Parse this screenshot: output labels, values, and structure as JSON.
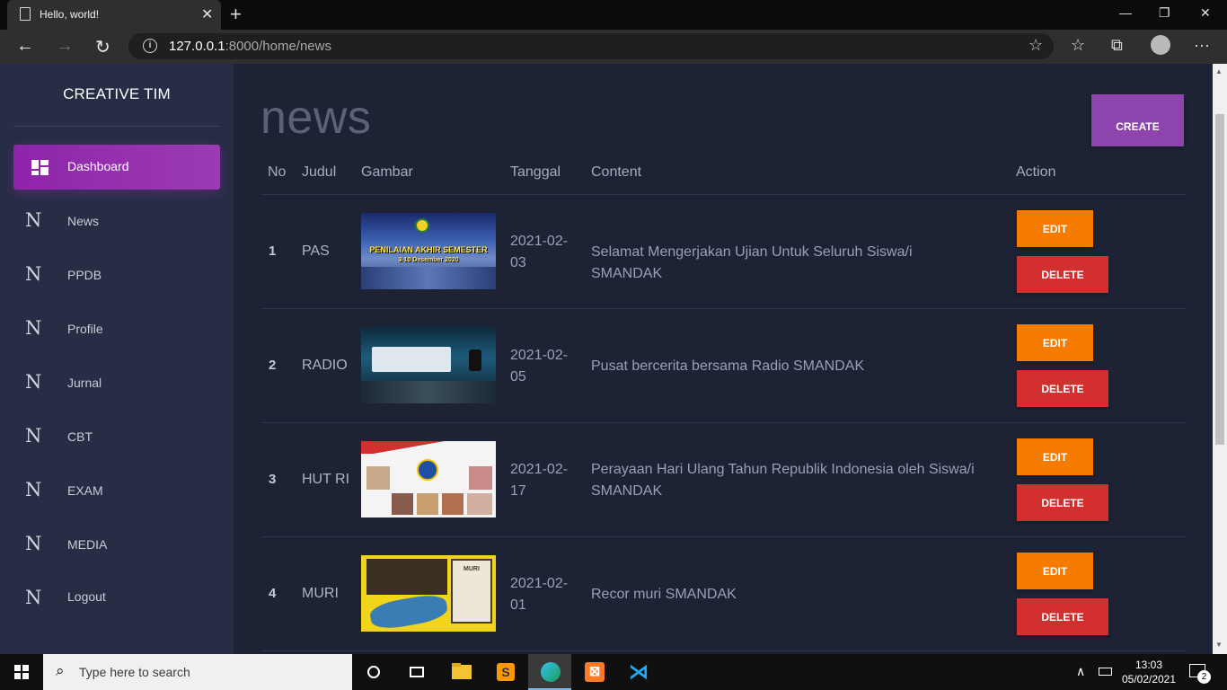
{
  "browser": {
    "tab_title": "Hello, world!",
    "url_host": "127.0.0.1",
    "url_rest": ":8000/home/news"
  },
  "sidebar": {
    "brand": "CREATIVE TIM",
    "active_item": "Dashboard",
    "items": [
      {
        "icon": "N",
        "label": "News"
      },
      {
        "icon": "N",
        "label": "PPDB"
      },
      {
        "icon": "N",
        "label": "Profile"
      },
      {
        "icon": "N",
        "label": "Jurnal"
      },
      {
        "icon": "N",
        "label": "CBT"
      },
      {
        "icon": "N",
        "label": "EXAM"
      },
      {
        "icon": "N",
        "label": "MEDIA"
      },
      {
        "icon": "N",
        "label": "Logout"
      }
    ]
  },
  "main": {
    "title": "news",
    "create_label": "CREATE",
    "columns": [
      "No",
      "Judul",
      "Gambar",
      "Tanggal",
      "Content",
      "Action"
    ],
    "rows": [
      {
        "no": "1",
        "judul": "PAS",
        "tanggal": "2021-02-03",
        "content": "Selamat Mengerjakan Ujian Untuk Seluruh Siswa/i SMANDAK",
        "img_text1": "PENILAIAN AKHIR SEMESTER",
        "img_text2": "3-10 Desember 2020"
      },
      {
        "no": "2",
        "judul": "RADIO",
        "tanggal": "2021-02-05",
        "content": "Pusat bercerita bersama Radio SMANDAK"
      },
      {
        "no": "3",
        "judul": "HUT RI",
        "tanggal": "2021-02-17",
        "content": "Perayaan Hari Ulang Tahun Republik Indonesia oleh Siswa/i SMANDAK"
      },
      {
        "no": "4",
        "judul": "MURI",
        "tanggal": "2021-02-01",
        "content": "Recor muri SMANDAK",
        "img_text1": "MURI"
      }
    ],
    "edit_label": "EDIT",
    "delete_label": "DELETE"
  },
  "taskbar": {
    "search_placeholder": "Type here to search",
    "time": "13:03",
    "date": "05/02/2021",
    "notifications": "2"
  }
}
